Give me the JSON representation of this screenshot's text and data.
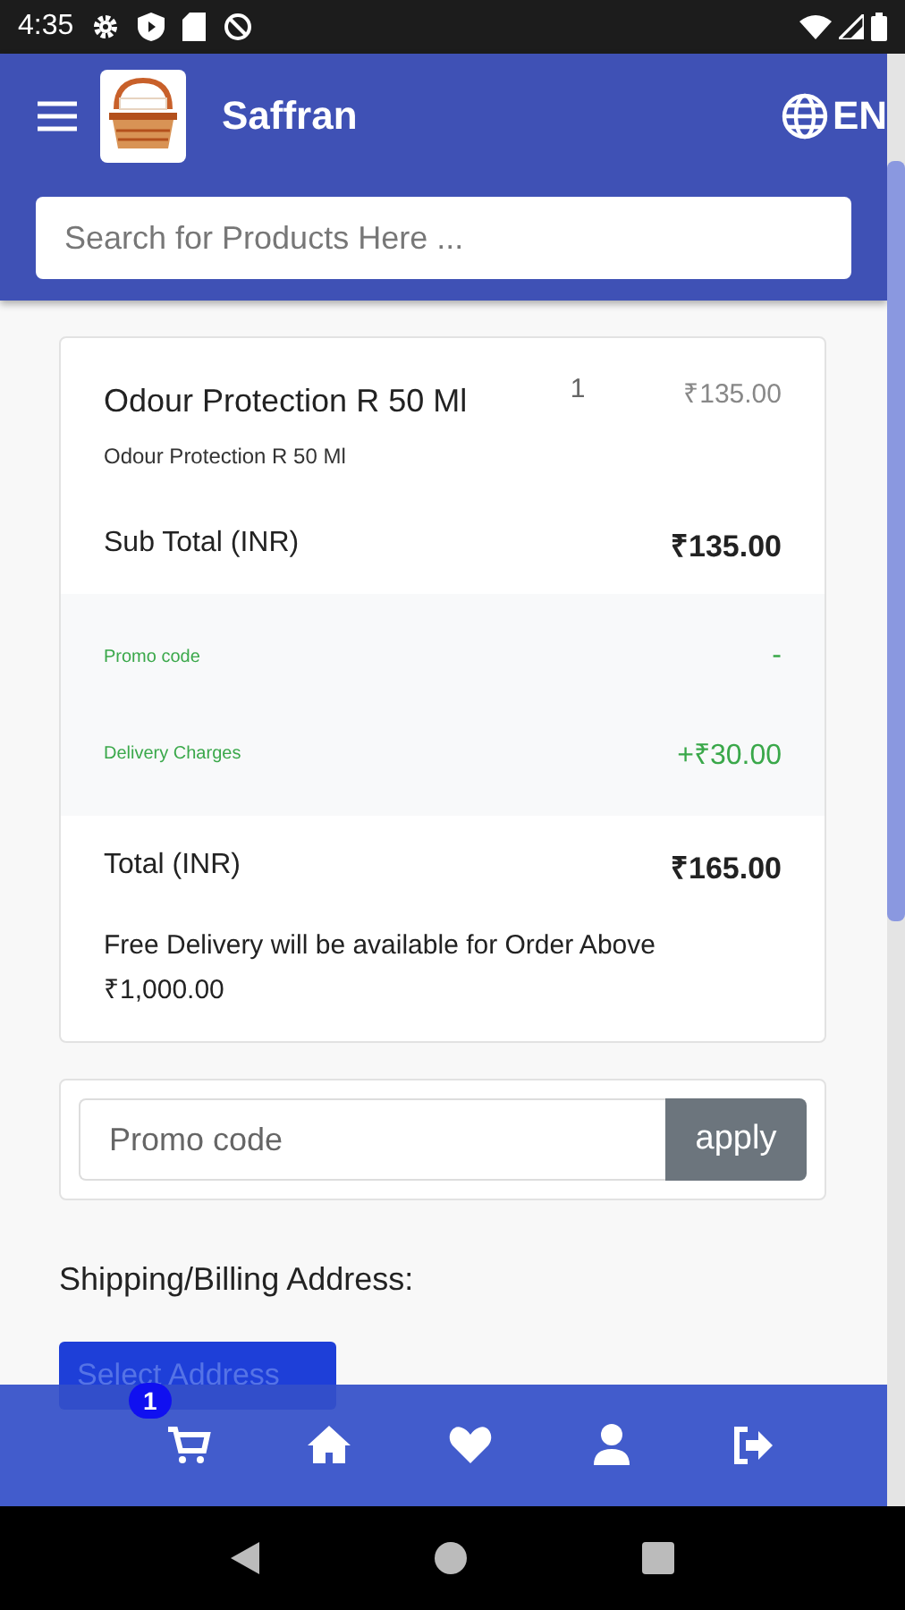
{
  "status_bar": {
    "time": "4:35"
  },
  "header": {
    "title": "Saffran",
    "language": "EN",
    "search": {
      "placeholder": "Search for Products Here ..."
    }
  },
  "cart": {
    "items": [
      {
        "name": "Odour Protection R 50 Ml",
        "description": "Odour Protection R 50 Ml",
        "quantity": "1",
        "price": "₹135.00"
      }
    ],
    "subtotal": {
      "label": "Sub Total (INR)",
      "value": "₹135.00"
    },
    "adjustments": [
      {
        "label": "Promo code",
        "value": "-"
      },
      {
        "label": "Delivery Charges",
        "value": "+₹30.00"
      }
    ],
    "total": {
      "label": "Total (INR)",
      "value": "₹165.00"
    },
    "note": "Free Delivery will be available for Order Above ₹1,000.00"
  },
  "promo": {
    "placeholder": "Promo code",
    "button": "apply"
  },
  "address": {
    "label": "Shipping/Billing Address:",
    "select": "Select Address"
  },
  "bottom_nav": [
    {
      "kind": "cart",
      "badge": "1"
    },
    {
      "kind": "home"
    },
    {
      "kind": "heart"
    },
    {
      "kind": "user"
    },
    {
      "kind": "logout"
    }
  ]
}
